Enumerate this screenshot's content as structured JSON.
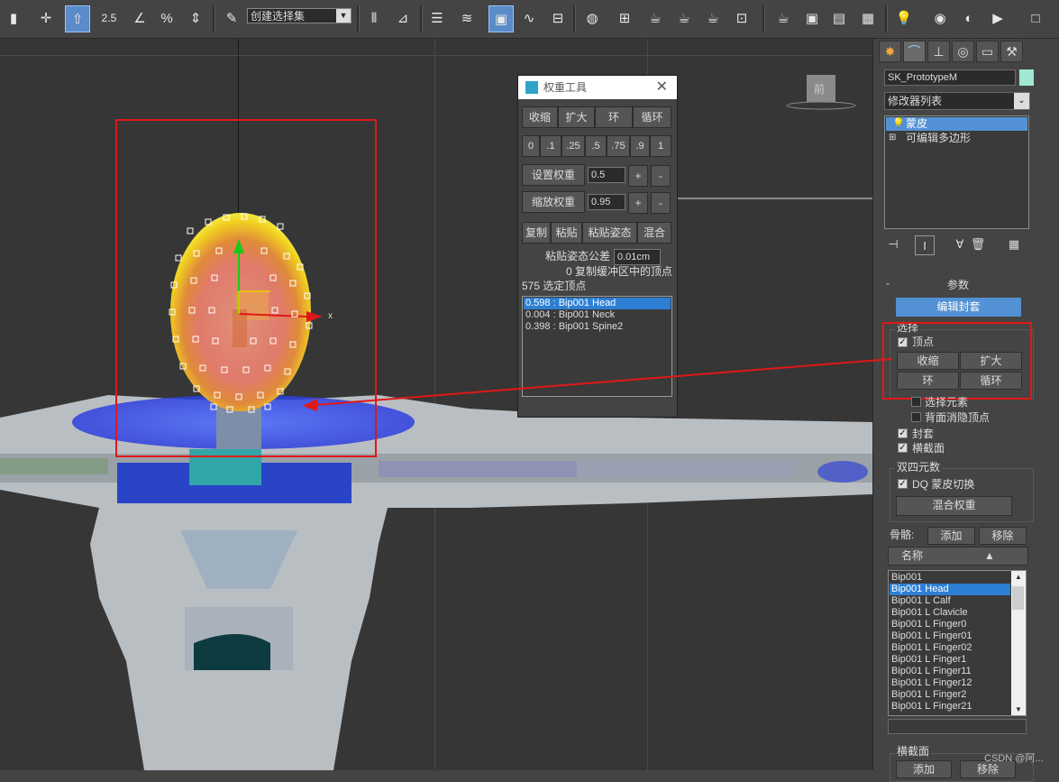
{
  "toolbar": {
    "selection_set": "创建选择集",
    "snap_label": "2.5",
    "percent_label": "%"
  },
  "viewport": {
    "viewcube_label": "前",
    "axis_x_label": "x"
  },
  "weight_tool": {
    "title": "权重工具",
    "row1": [
      "收缩",
      "扩大",
      "环",
      "循环"
    ],
    "presets": [
      "0",
      ".1",
      ".25",
      ".5",
      ".75",
      ".9",
      "1"
    ],
    "set_weight_label": "设置权重",
    "set_weight_value": "0.5",
    "scale_weight_label": "缩放权重",
    "scale_weight_value": "0.95",
    "plus": "+",
    "minus": "-",
    "row4": [
      "复制",
      "粘贴",
      "粘贴姿态",
      "混合"
    ],
    "paste_tol_label": "粘贴姿态公差",
    "paste_tol_value": "0.01cm",
    "buffer_text": "0 复制缓冲区中的顶点",
    "selected_text": "575 选定顶点",
    "weights": [
      {
        "text": "0.598 : Bip001 Head",
        "selected": true
      },
      {
        "text": "0.004 : Bip001 Neck",
        "selected": false
      },
      {
        "text": "0.398 : Bip001 Spine2",
        "selected": false
      }
    ]
  },
  "panel": {
    "object_name": "SK_PrototypeM",
    "modifier_list": "修改器列表",
    "stack": [
      {
        "label": "蒙皮",
        "selected": true
      },
      {
        "label": "可编辑多边形",
        "selected": false
      }
    ],
    "params_title": "参数",
    "edit_envelope": "编辑封套",
    "select_group": "选择",
    "vertices_label": "顶点",
    "shrink": "收缩",
    "grow": "扩大",
    "ring": "环",
    "loop": "循环",
    "select_element": "选择元素",
    "backface_cull": "背面消隐顶点",
    "envelopes": "封套",
    "cross_sections": "横截面",
    "dual_quat_group": "双四元数",
    "dq_toggle": "DQ 蒙皮切换",
    "blend_weights": "混合权重",
    "bones_label": "骨骼:",
    "add": "添加",
    "remove": "移除",
    "name_header": "名称",
    "cross_section_group": "横截面",
    "bones": [
      {
        "name": "Bip001",
        "selected": false
      },
      {
        "name": "Bip001 Head",
        "selected": true
      },
      {
        "name": "Bip001 L Calf",
        "selected": false
      },
      {
        "name": "Bip001 L Clavicle",
        "selected": false
      },
      {
        "name": "Bip001 L Finger0",
        "selected": false
      },
      {
        "name": "Bip001 L Finger01",
        "selected": false
      },
      {
        "name": "Bip001 L Finger02",
        "selected": false
      },
      {
        "name": "Bip001 L Finger1",
        "selected": false
      },
      {
        "name": "Bip001 L Finger11",
        "selected": false
      },
      {
        "name": "Bip001 L Finger12",
        "selected": false
      },
      {
        "name": "Bip001 L Finger2",
        "selected": false
      },
      {
        "name": "Bip001 L Finger21",
        "selected": false
      }
    ]
  },
  "watermark": "CSDN @阿..."
}
